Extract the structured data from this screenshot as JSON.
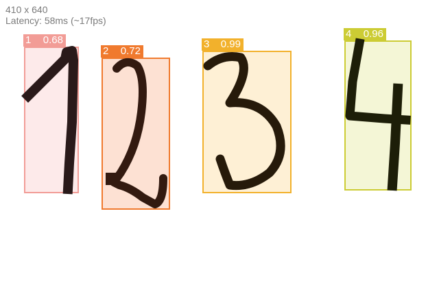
{
  "info": {
    "resolution": "410 x 640",
    "latency": "Latency: 58ms (~17fps)"
  },
  "detections": [
    {
      "label": "1",
      "score": "0.68",
      "color": "#f29c96",
      "fill": "#fdeaea"
    },
    {
      "label": "2",
      "score": "0.72",
      "color": "#f07a2e",
      "fill": "#fde1d3"
    },
    {
      "label": "3",
      "score": "0.99",
      "color": "#f2b12c",
      "fill": "#fef0d5"
    },
    {
      "label": "4",
      "score": "0.96",
      "color": "#cccc34",
      "fill": "#f4f6d6"
    }
  ]
}
